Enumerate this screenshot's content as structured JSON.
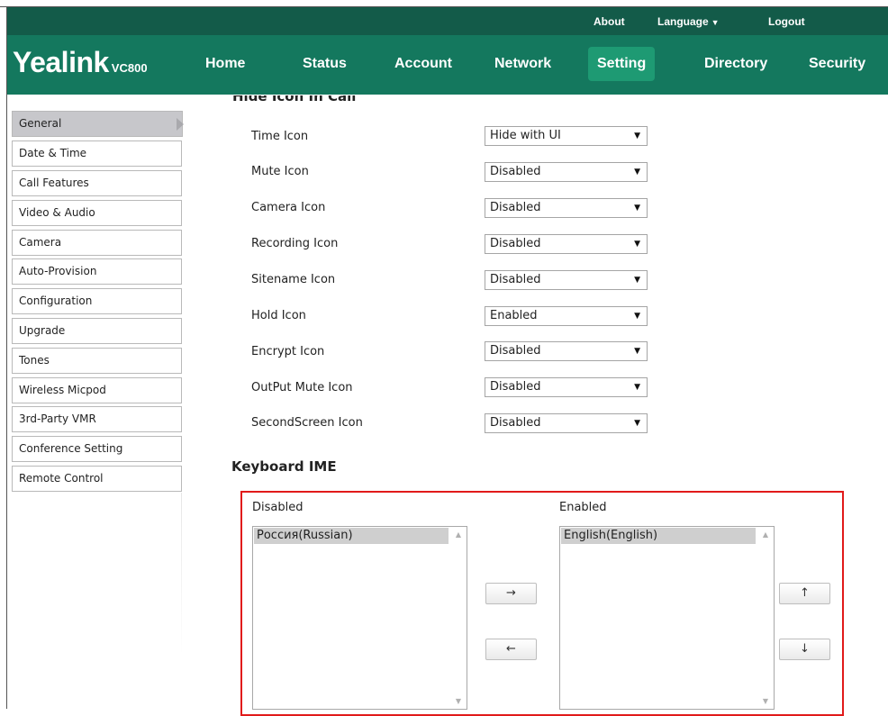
{
  "topbar": {
    "about": "About",
    "language": "Language",
    "logout": "Logout"
  },
  "brand": {
    "logo": "Yealink",
    "model": "VC800"
  },
  "nav": {
    "home": "Home",
    "status": "Status",
    "account": "Account",
    "network": "Network",
    "setting": "Setting",
    "directory": "Directory",
    "security": "Security"
  },
  "sidebar": {
    "items": [
      {
        "label": "General"
      },
      {
        "label": "Date & Time"
      },
      {
        "label": "Call Features"
      },
      {
        "label": "Video & Audio"
      },
      {
        "label": "Camera"
      },
      {
        "label": "Auto-Provision"
      },
      {
        "label": "Configuration"
      },
      {
        "label": "Upgrade"
      },
      {
        "label": "Tones"
      },
      {
        "label": "Wireless Micpod"
      },
      {
        "label": "3rd-Party VMR"
      },
      {
        "label": "Conference Setting"
      },
      {
        "label": "Remote Control"
      }
    ]
  },
  "section_partial": "Hide Icon In Call",
  "rows": [
    {
      "label": "Time Icon",
      "value": "Hide with UI"
    },
    {
      "label": "Mute Icon",
      "value": "Disabled"
    },
    {
      "label": "Camera Icon",
      "value": "Disabled"
    },
    {
      "label": "Recording Icon",
      "value": "Disabled"
    },
    {
      "label": "Sitename Icon",
      "value": "Disabled"
    },
    {
      "label": "Hold Icon",
      "value": "Enabled"
    },
    {
      "label": "Encrypt Icon",
      "value": "Disabled"
    },
    {
      "label": "OutPut Mute Icon",
      "value": "Disabled"
    },
    {
      "label": "SecondScreen Icon",
      "value": "Disabled"
    }
  ],
  "keyboard_ime": {
    "title": "Keyboard IME",
    "disabled_label": "Disabled",
    "enabled_label": "Enabled",
    "disabled_items": [
      "Россия(Russian)"
    ],
    "enabled_items": [
      "English(English)"
    ],
    "move_right": "→",
    "move_left": "←",
    "move_up": "↑",
    "move_down": "↓"
  },
  "colors": {
    "topbar": "#135b49",
    "navbar": "#14785e",
    "active_tab": "#1e9a73",
    "highlight_border": "#e11a1a"
  }
}
